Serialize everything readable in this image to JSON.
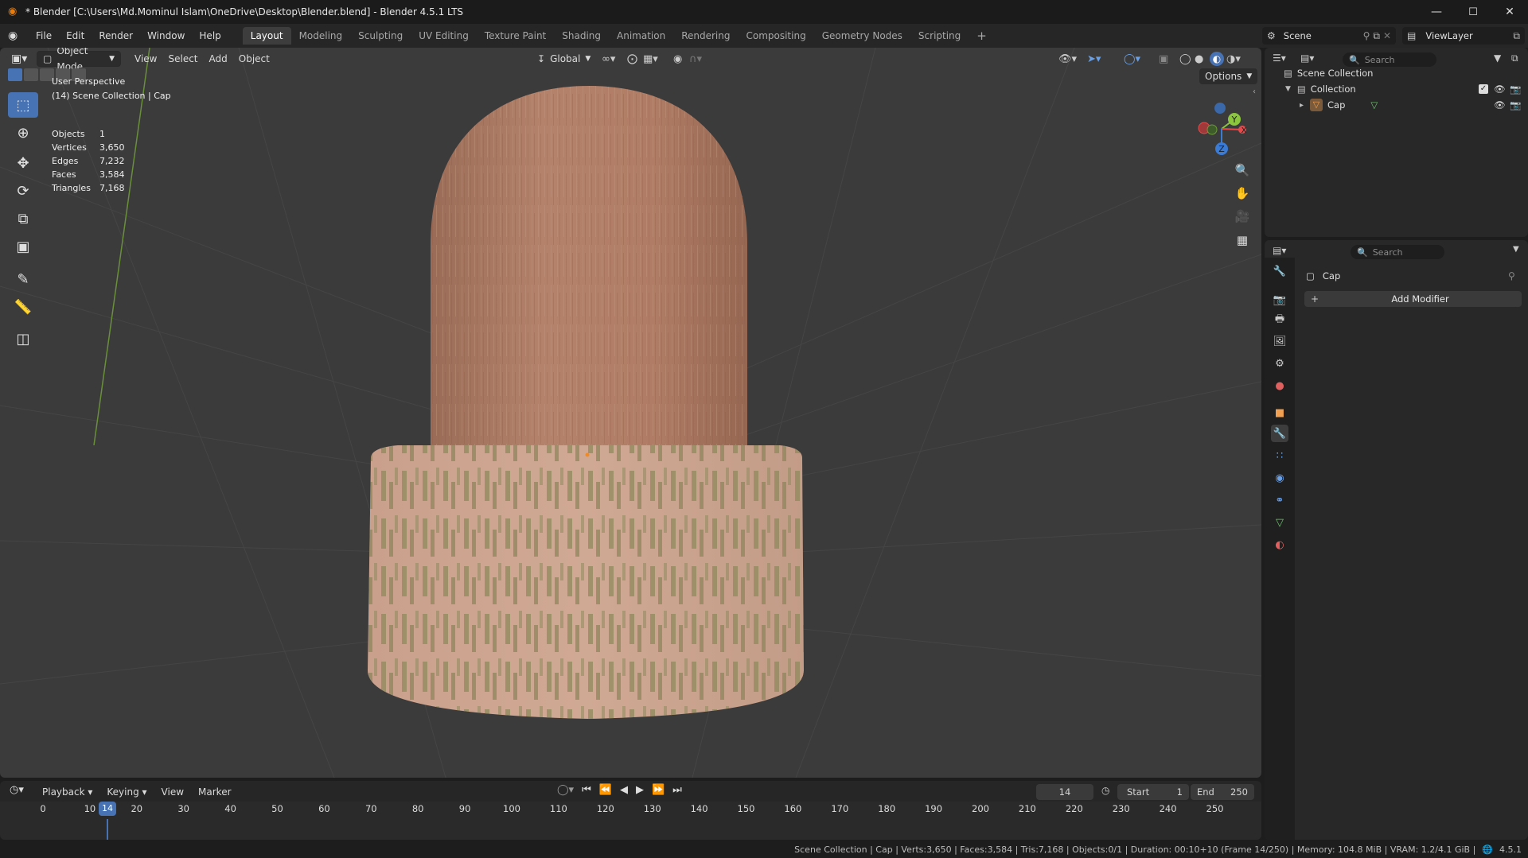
{
  "window": {
    "title": "* Blender [C:\\Users\\Md.Mominul Islam\\OneDrive\\Desktop\\Blender.blend] - Blender 4.5.1 LTS",
    "minimize": "—",
    "maximize": "☐",
    "close": "✕"
  },
  "menu": [
    "File",
    "Edit",
    "Render",
    "Window",
    "Help"
  ],
  "workspaces": [
    "Layout",
    "Modeling",
    "Sculpting",
    "UV Editing",
    "Texture Paint",
    "Shading",
    "Animation",
    "Rendering",
    "Compositing",
    "Geometry Nodes",
    "Scripting"
  ],
  "workspace_add": "+",
  "scene": {
    "label": "Scene",
    "viewlayer": "ViewLayer",
    "search_placeholder": "Search"
  },
  "viewport_header": {
    "mode": "Object Mode",
    "menus": [
      "View",
      "Select",
      "Add",
      "Object"
    ],
    "transform_orientation": "Global",
    "options": "Options"
  },
  "viewport_overlay": {
    "perspective": "User Perspective",
    "context": "(14) Scene Collection | Cap",
    "stats": [
      {
        "label": "Objects",
        "value": "1"
      },
      {
        "label": "Vertices",
        "value": "3,650"
      },
      {
        "label": "Edges",
        "value": "7,232"
      },
      {
        "label": "Faces",
        "value": "3,584"
      },
      {
        "label": "Triangles",
        "value": "7,168"
      }
    ]
  },
  "gizmo": {
    "x": "X",
    "y": "Y",
    "z": "Z"
  },
  "outliner": {
    "root": "Scene Collection",
    "collection": "Collection",
    "object": "Cap"
  },
  "properties": {
    "search_placeholder": "Search",
    "object_name": "Cap",
    "add_modifier": "Add Modifier"
  },
  "timeline": {
    "menus": [
      "Playback",
      "Keying",
      "View",
      "Marker"
    ],
    "current_frame": "14",
    "start_label": "Start",
    "start": "1",
    "end_label": "End",
    "end": "250",
    "ticks": [
      "0",
      "10",
      "20",
      "30",
      "40",
      "50",
      "60",
      "70",
      "80",
      "90",
      "100",
      "110",
      "120",
      "130",
      "140",
      "150",
      "160",
      "170",
      "180",
      "190",
      "200",
      "210",
      "220",
      "230",
      "240",
      "250"
    ],
    "playhead": "14"
  },
  "statusbar": {
    "text": "Scene Collection | Cap | Verts:3,650 | Faces:3,584 | Tris:7,168 | Objects:0/1 | Duration: 00:10+10 (Frame 14/250) | Memory: 104.8 MiB | VRAM: 1.2/4.1 GiB |",
    "version": "4.5.1"
  },
  "colors": {
    "accent": "#4772b3",
    "viewport_bg": "#3b3b3b",
    "cap_top": "#b07d66",
    "cap_base": "#c29a86",
    "cap_streak": "#8f8a5f"
  },
  "icons": {
    "blender_logo": "blender-logo-icon",
    "tools": [
      "select-box-icon",
      "cursor-icon",
      "move-icon",
      "rotate-icon",
      "scale-icon",
      "transform-icon",
      "annotate-icon",
      "measure-icon",
      "add-cube-icon"
    ],
    "nav": [
      "zoom-icon",
      "hand-pan-icon",
      "camera-icon",
      "grid-ortho-icon"
    ],
    "prop_tabs": [
      "tool-icon",
      "render-icon",
      "output-icon",
      "view-layer-icon",
      "scene-icon",
      "world-icon",
      "object-icon",
      "modifier-icon",
      "particles-icon",
      "physics-icon",
      "constraints-icon",
      "data-icon",
      "material-icon"
    ]
  }
}
